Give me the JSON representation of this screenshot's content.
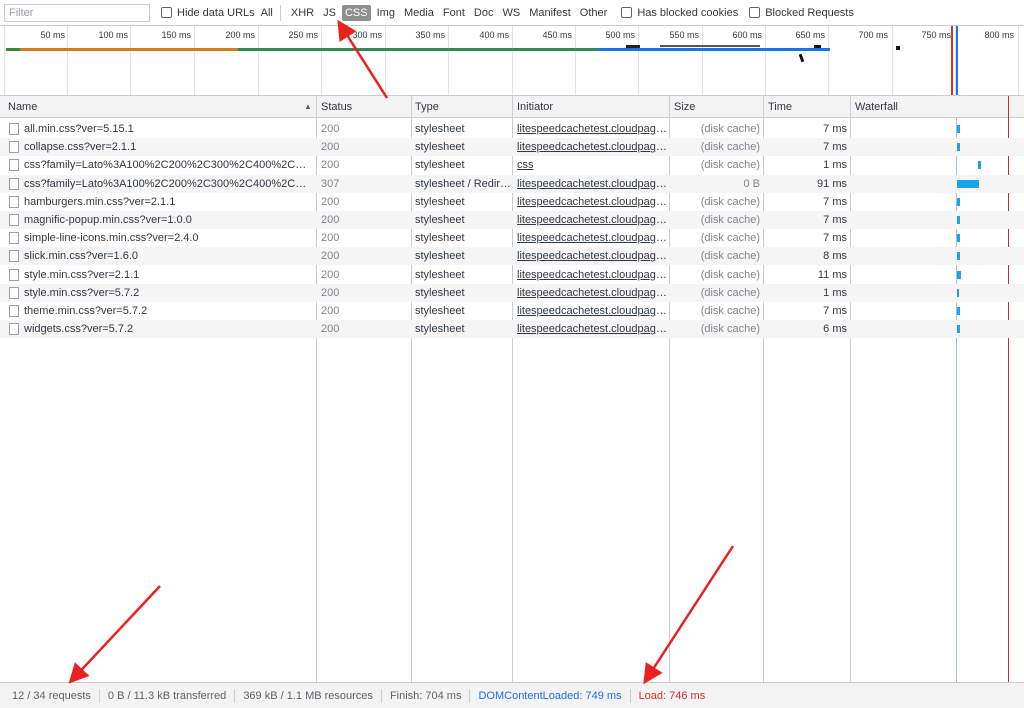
{
  "filter": {
    "placeholder": "Filter"
  },
  "checkboxes": {
    "hide_data_urls": "Hide data URLs",
    "has_blocked_cookies": "Has blocked cookies",
    "blocked_requests": "Blocked Requests"
  },
  "types": [
    {
      "label": "All",
      "active": false
    },
    {
      "label": "XHR",
      "active": false
    },
    {
      "label": "JS",
      "active": false
    },
    {
      "label": "CSS",
      "active": true
    },
    {
      "label": "Img",
      "active": false
    },
    {
      "label": "Media",
      "active": false
    },
    {
      "label": "Font",
      "active": false
    },
    {
      "label": "Doc",
      "active": false
    },
    {
      "label": "WS",
      "active": false
    },
    {
      "label": "Manifest",
      "active": false
    },
    {
      "label": "Other",
      "active": false
    }
  ],
  "timeline_ticks": [
    "50 ms",
    "100 ms",
    "150 ms",
    "200 ms",
    "250 ms",
    "300 ms",
    "350 ms",
    "400 ms",
    "450 ms",
    "500 ms",
    "550 ms",
    "600 ms",
    "650 ms",
    "700 ms",
    "750 ms",
    "800 ms"
  ],
  "columns": {
    "name": "Name",
    "status": "Status",
    "type": "Type",
    "initiator": "Initiator",
    "size": "Size",
    "time": "Time",
    "waterfall": "Waterfall"
  },
  "rows": [
    {
      "name": "all.min.css?ver=5.15.1",
      "status": "200",
      "type": "stylesheet",
      "initiator": "litespeedcachetest.cloudpages...",
      "size": "(disk cache)",
      "time": "7 ms"
    },
    {
      "name": "collapse.css?ver=2.1.1",
      "status": "200",
      "type": "stylesheet",
      "initiator": "litespeedcachetest.cloudpages...",
      "size": "(disk cache)",
      "time": "7 ms"
    },
    {
      "name": "css?family=Lato%3A100%2C200%2C300%2C400%2C500%2...",
      "status": "200",
      "type": "stylesheet",
      "initiator": "css",
      "size": "(disk cache)",
      "time": "1 ms"
    },
    {
      "name": "css?family=Lato%3A100%2C200%2C300%2C400%2C500%2...",
      "status": "307",
      "type": "stylesheet / Redirect",
      "initiator": "litespeedcachetest.cloudpages...",
      "size": "0 B",
      "time": "91 ms"
    },
    {
      "name": "hamburgers.min.css?ver=2.1.1",
      "status": "200",
      "type": "stylesheet",
      "initiator": "litespeedcachetest.cloudpages...",
      "size": "(disk cache)",
      "time": "7 ms"
    },
    {
      "name": "magnific-popup.min.css?ver=1.0.0",
      "status": "200",
      "type": "stylesheet",
      "initiator": "litespeedcachetest.cloudpages...",
      "size": "(disk cache)",
      "time": "7 ms"
    },
    {
      "name": "simple-line-icons.min.css?ver=2.4.0",
      "status": "200",
      "type": "stylesheet",
      "initiator": "litespeedcachetest.cloudpages...",
      "size": "(disk cache)",
      "time": "7 ms"
    },
    {
      "name": "slick.min.css?ver=1.6.0",
      "status": "200",
      "type": "stylesheet",
      "initiator": "litespeedcachetest.cloudpages...",
      "size": "(disk cache)",
      "time": "8 ms"
    },
    {
      "name": "style.min.css?ver=2.1.1",
      "status": "200",
      "type": "stylesheet",
      "initiator": "litespeedcachetest.cloudpages...",
      "size": "(disk cache)",
      "time": "11 ms"
    },
    {
      "name": "style.min.css?ver=5.7.2",
      "status": "200",
      "type": "stylesheet",
      "initiator": "litespeedcachetest.cloudpages...",
      "size": "(disk cache)",
      "time": "1 ms"
    },
    {
      "name": "theme.min.css?ver=5.7.2",
      "status": "200",
      "type": "stylesheet",
      "initiator": "litespeedcachetest.cloudpages...",
      "size": "(disk cache)",
      "time": "7 ms"
    },
    {
      "name": "widgets.css?ver=5.7.2",
      "status": "200",
      "type": "stylesheet",
      "initiator": "litespeedcachetest.cloudpages...",
      "size": "(disk cache)",
      "time": "6 ms"
    }
  ],
  "status_bar": {
    "requests": "12 / 34 requests",
    "transferred": "0 B / 11.3 kB transferred",
    "resources": "369 kB / 1.1 MB resources",
    "finish": "Finish: 704 ms",
    "dom_content_loaded": "DOMContentLoaded: 749 ms",
    "load": "Load: 746 ms"
  },
  "colors": {
    "active_filter": "#8f8f8f",
    "dcl_blue": "#1a73e8",
    "load_red": "#d93025",
    "waterfall_bar": "#1aa3e8",
    "annotation_arrow": "#e8231f"
  }
}
